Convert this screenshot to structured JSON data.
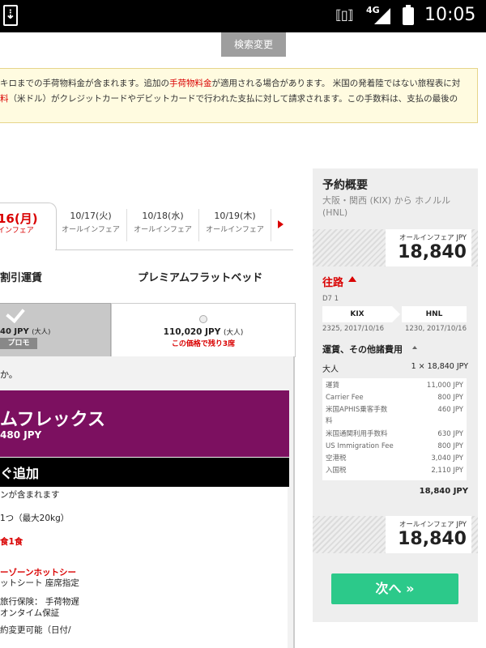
{
  "status_bar": {
    "network": "4G",
    "time": "10:05",
    "download_glyph": "⇣",
    "vibrate_glyph": "⟦▯⟧"
  },
  "search_change_label": "検索変更",
  "notice": {
    "line1_a": "キロまでの手荷物料金が含まれます。追加の",
    "line1_link": "手荷物料金",
    "line1_b": "が適用される場合があります。 米国の発着陸ではない旅程表に対",
    "line2_a": "料",
    "line2_b": "（米ドル）がクレジットカードやデビットカードで行われた支払に対して請求されます。この手数料は、支払の最後の"
  },
  "date_tabs": {
    "active": {
      "date": "16(月)",
      "sub": "インフェア"
    },
    "items": [
      {
        "date": "10/17(火)",
        "sub": "オールインフェア"
      },
      {
        "date": "10/18(水)",
        "sub": "オールインフェア"
      },
      {
        "date": "10/19(木)",
        "sub": "オールインフェア"
      }
    ]
  },
  "fare_classes": {
    "discount": "割引運賃",
    "premium": "プレミアムフラットベッド"
  },
  "fare_selected": {
    "price": "40 JPY",
    "price_suffix": "(大人)",
    "badge": "プロモ"
  },
  "fare_other": {
    "price": "110,020 JPY",
    "price_suffix": "(大人)",
    "seats_left": "この価格で残り3席"
  },
  "question_text": "か。",
  "flex": {
    "title": "ムフレックス",
    "price": "480 JPY",
    "add_label": "ぐ追加"
  },
  "benefits": [
    {
      "text": "ンが含まれます",
      "red": false
    },
    {
      "text": "1つ（最大20kg）",
      "red": false
    },
    {
      "text": "食1食",
      "red": true
    },
    {
      "text": "ーゾーンホットシー",
      "red": true
    },
    {
      "text": "ットシート 座席指定",
      "red": false
    },
    {
      "text": "旅行保険： 手荷物遅",
      "red": false
    },
    {
      "text": "オンタイム保証",
      "red": false
    },
    {
      "text": "約変更可能（日付/",
      "red": false
    }
  ],
  "summary": {
    "title": "予約概要",
    "route": "大阪・関西 (KIX) から ホノルル (HNL)",
    "price_label": "オールインフェア JPY",
    "price": "18,840",
    "outbound": "往路",
    "flight_no": "D7 1",
    "from": "KIX",
    "to": "HNL",
    "dep_time": "2325, 2017/10/16",
    "arr_time": "1230, 2017/10/16",
    "fees_heading": "運賃、その他諸費用",
    "pax_label": "大人",
    "pax_value": "1 × 18,840 JPY",
    "fees": [
      {
        "label": "運賃",
        "value": "11,000 JPY"
      },
      {
        "label": "Carrier Fee",
        "value": "800 JPY"
      },
      {
        "label": "米国APHIS乗客手数",
        "value": "460 JPY"
      },
      {
        "label": "料",
        "value": ""
      },
      {
        "label": "米国通関利用手数料",
        "value": "630 JPY"
      },
      {
        "label": "US Immigration Fee",
        "value": "800 JPY"
      },
      {
        "label": "空港税",
        "value": "3,040 JPY"
      },
      {
        "label": "入国税",
        "value": "2,110 JPY"
      }
    ],
    "total": "18,840 JPY",
    "next_label": "次へ »"
  },
  "colors": {
    "accent_red": "#d90000",
    "flex_purple": "#7c1060",
    "next_green": "#2cc98a"
  }
}
